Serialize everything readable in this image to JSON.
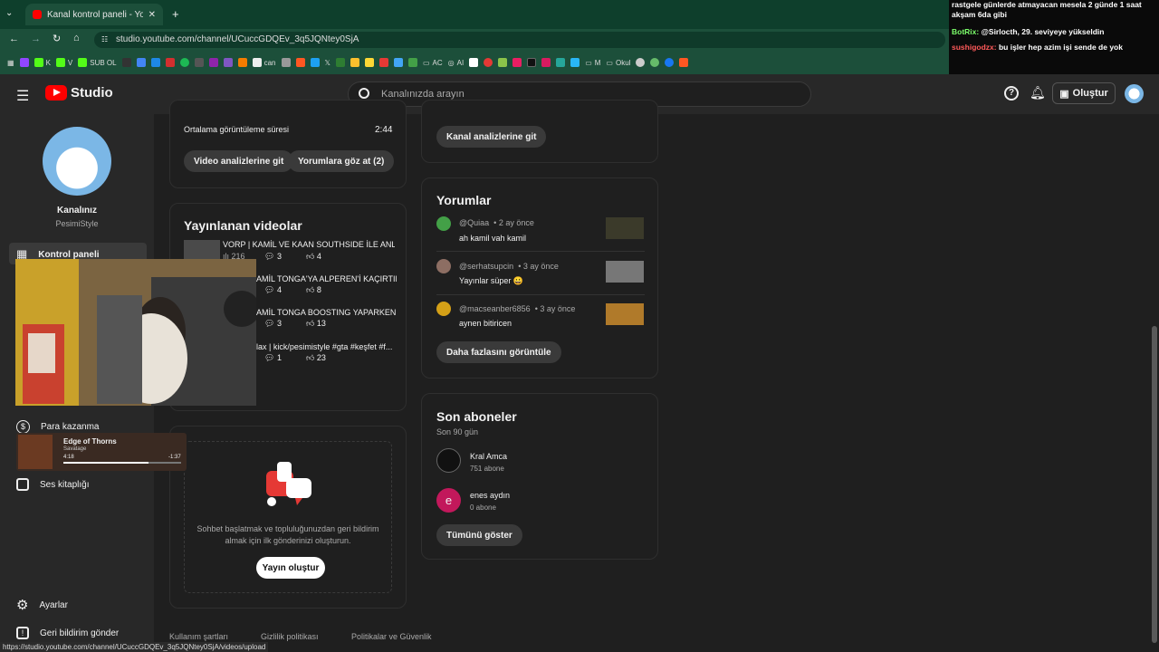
{
  "browser": {
    "tab_title": "Kanal kontrol paneli - YouTube",
    "url": "studio.youtube.com/channel/UCuccGDQEv_3q5JQNtey0SjA",
    "status_url": "https://studio.youtube.com/channel/UCuccGDQEv_3q5JQNtey0SjA/videos/upload",
    "bookmarks": [
      "K",
      "V",
      "SUB OL",
      "can",
      "AC",
      "AI",
      "M",
      "Okul"
    ]
  },
  "chat": [
    {
      "text": "rastgele günlerde atmayacan mesela 2 günde 1 saat akşam 6da gibi"
    },
    {
      "user": "BotRix:",
      "text": "@Sirlocth, 29. seviyeye yükseldin"
    },
    {
      "user": "sushigodzx:",
      "text": "bu işler hep azim işi sende de yok"
    }
  ],
  "header": {
    "logo_text": "Studio",
    "search_placeholder": "Kanalınızda arayın",
    "create_label": "Oluştur"
  },
  "sidebar": {
    "channel_title": "Kanalınız",
    "channel_name": "PesimiStyle",
    "items": {
      "dashboard": "Kontrol paneli",
      "monetization": "Para kazanma",
      "audio": "Ses kitaplığı",
      "settings": "Ayarlar",
      "feedback": "Geri bildirim gönder"
    }
  },
  "video_card": {
    "avg_label": "Ortalama görüntüleme süresi",
    "avg_value": "2:44",
    "btn_analytics": "Video analizlerine git",
    "btn_comments": "Yorumlara göz at (2)"
  },
  "published": {
    "title": "Yayınlanan videolar",
    "videos": [
      {
        "title": "VORP | KAMİL VE KAAN SOUTHSIDE İLE ANLA...",
        "views": "216",
        "comments": "3",
        "likes": "4"
      },
      {
        "title": "AMİL TONGA'YA ALPEREN'İ KAÇIRTIP...",
        "comments": "4",
        "likes": "8"
      },
      {
        "title": "AMİL TONGA BOOSTING YAPARKEN ...",
        "comments": "3",
        "likes": "13"
      },
      {
        "title": "lax | kick/pesimistyle #gta #keşfet #f...",
        "comments": "1",
        "likes": "23"
      }
    ]
  },
  "post_card": {
    "text_line1": "Sohbet başlatmak ve topluluğunuzdan geri bildirim",
    "text_line2": "almak için ilk gönderinizi oluşturun.",
    "button": "Yayın oluştur"
  },
  "analytics_btn": "Kanal analizlerine git",
  "comments": {
    "title": "Yorumlar",
    "items": [
      {
        "user": "@Quiaa",
        "time": "• 2 ay önce",
        "text": "ah kamil vah kamil"
      },
      {
        "user": "@serhatsupcin",
        "time": "• 3 ay önce",
        "text": "Yayınlar süper 😀"
      },
      {
        "user": "@macseanber6856",
        "time": "• 3 ay önce",
        "text": "aynen bitiricen"
      }
    ],
    "more": "Daha fazlasını görüntüle"
  },
  "subscribers": {
    "title": "Son aboneler",
    "subtitle": "Son 90 gün",
    "items": [
      {
        "name": "Kral Amca",
        "count": "751 abone"
      },
      {
        "initial": "e",
        "name": "enes aydın",
        "count": "0 abone"
      }
    ],
    "show_all": "Tümünü göster"
  },
  "music": {
    "title": "Edge of Thorns",
    "artist": "Savatage",
    "elapsed": "4:18",
    "remaining": "-1:37",
    "progress": 0.72
  },
  "footer": {
    "terms": "Kullanım şartları",
    "privacy": "Gizlilik politikası",
    "policies": "Politikalar ve Güvenlik"
  },
  "colors": {
    "browser": "#1c4f3a",
    "accent_red": "#ff0000",
    "background": "#1f1f1f",
    "panel": "#282828",
    "subscriber_pink": "#c2185b"
  }
}
